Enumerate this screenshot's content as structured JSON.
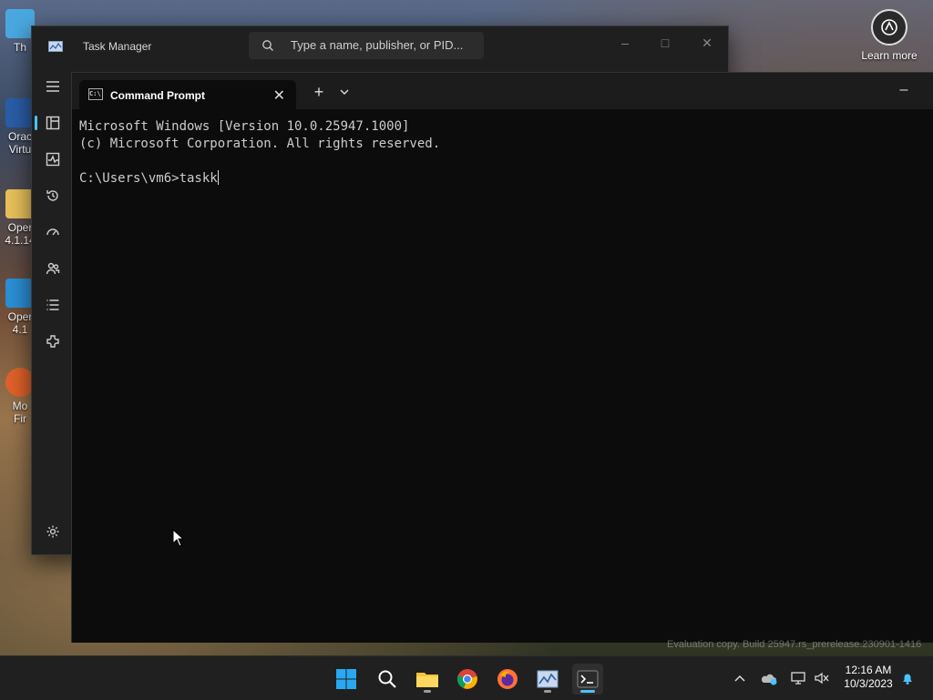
{
  "desktop": {
    "icons": [
      {
        "label": "Th"
      },
      {
        "label": "Orac\nVirtu"
      },
      {
        "label": "Oper\n4.1.14"
      },
      {
        "label": "Oper\n4.1"
      },
      {
        "label": "Mo\nFir"
      }
    ],
    "learn_more": "Learn more"
  },
  "task_manager": {
    "title": "Task Manager",
    "search_placeholder": "Type a name, publisher, or PID...",
    "nav": [
      "menu",
      "processes",
      "performance",
      "app-history",
      "startup-apps",
      "users",
      "details",
      "services"
    ],
    "settings_icon": "gear-icon"
  },
  "terminal": {
    "tab_title": "Command Prompt",
    "new_tab": "+",
    "lines": [
      "Microsoft Windows [Version 10.0.25947.1000]",
      "(c) Microsoft Corporation. All rights reserved.",
      "",
      "C:\\Users\\vm6>taskk"
    ]
  },
  "watermark": "Evaluation copy. Build 25947.rs_prerelease.230901-1416",
  "taskbar": {
    "apps": [
      "start-icon",
      "search-icon",
      "file-explorer-icon",
      "chrome-icon",
      "firefox-icon",
      "task-manager-icon",
      "terminal-icon"
    ],
    "clock_time": "12:16 AM",
    "clock_date": "10/3/2023",
    "accent": "#4cc2ff"
  }
}
